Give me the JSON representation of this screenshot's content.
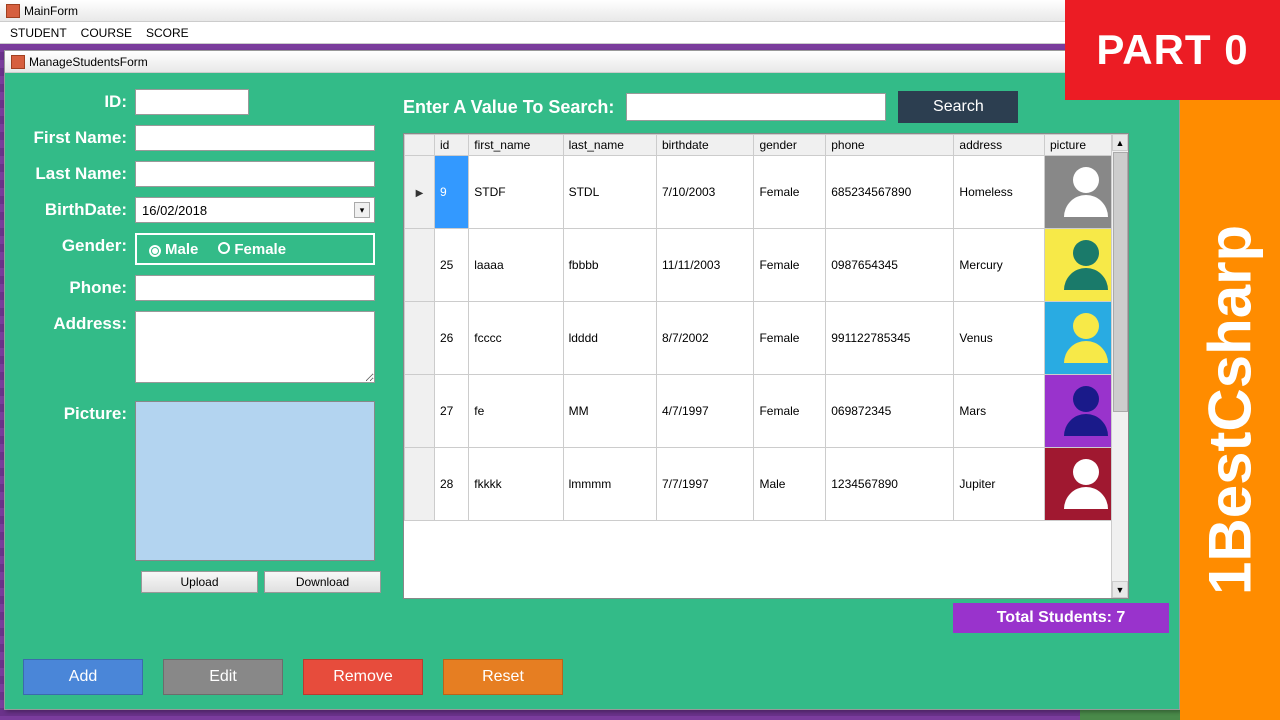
{
  "overlay": {
    "part": "PART 0",
    "brand": "1BestCsharp"
  },
  "mainWindow": {
    "title": "MainForm"
  },
  "menu": {
    "student": "STUDENT",
    "course": "COURSE",
    "score": "SCORE"
  },
  "childWindow": {
    "title": "ManageStudentsForm"
  },
  "form": {
    "id_label": "ID:",
    "id_value": "",
    "firstname_label": "First Name:",
    "firstname_value": "",
    "lastname_label": "Last Name:",
    "lastname_value": "",
    "birthdate_label": "BirthDate:",
    "birthdate_value": "16/02/2018",
    "gender_label": "Gender:",
    "gender_male": "Male",
    "gender_female": "Female",
    "phone_label": "Phone:",
    "phone_value": "",
    "address_label": "Address:",
    "address_value": "",
    "picture_label": "Picture:",
    "upload_btn": "Upload",
    "download_btn": "Download"
  },
  "search": {
    "label": "Enter A Value To Search:",
    "button": "Search"
  },
  "grid": {
    "headers": [
      "id",
      "first_name",
      "last_name",
      "birthdate",
      "gender",
      "phone",
      "address",
      "picture"
    ],
    "rows": [
      {
        "selected": true,
        "id": "9",
        "first_name": "STDF",
        "last_name": "STDL",
        "birthdate": "7/10/2003",
        "gender": "Female",
        "phone": "685234567890",
        "address": "Homeless",
        "pic": {
          "bg": "#888888",
          "fg": "#ffffff"
        }
      },
      {
        "id": "25",
        "first_name": "laaaa",
        "last_name": "fbbbb",
        "birthdate": "11/11/2003",
        "gender": "Female",
        "phone": "0987654345",
        "address": "Mercury",
        "pic": {
          "bg": "#f7e948",
          "fg": "#1a7a6a"
        }
      },
      {
        "id": "26",
        "first_name": "fcccc",
        "last_name": "ldddd",
        "birthdate": "8/7/2002",
        "gender": "Female",
        "phone": "991122785345",
        "address": "Venus",
        "pic": {
          "bg": "#29abe2",
          "fg": "#f7e948"
        }
      },
      {
        "id": "27",
        "first_name": "fe",
        "last_name": "MM",
        "birthdate": "4/7/1997",
        "gender": "Female",
        "phone": "069872345",
        "address": "Mars",
        "pic": {
          "bg": "#9933cc",
          "fg": "#1a1a8a"
        }
      },
      {
        "id": "28",
        "first_name": "fkkkk",
        "last_name": "lmmmm",
        "birthdate": "7/7/1997",
        "gender": "Male",
        "phone": "1234567890",
        "address": "Jupiter",
        "pic": {
          "bg": "#a01830",
          "fg": "#ffffff"
        }
      }
    ]
  },
  "footer": {
    "total": "Total Students: 7"
  },
  "actions": {
    "add": "Add",
    "edit": "Edit",
    "remove": "Remove",
    "reset": "Reset"
  }
}
